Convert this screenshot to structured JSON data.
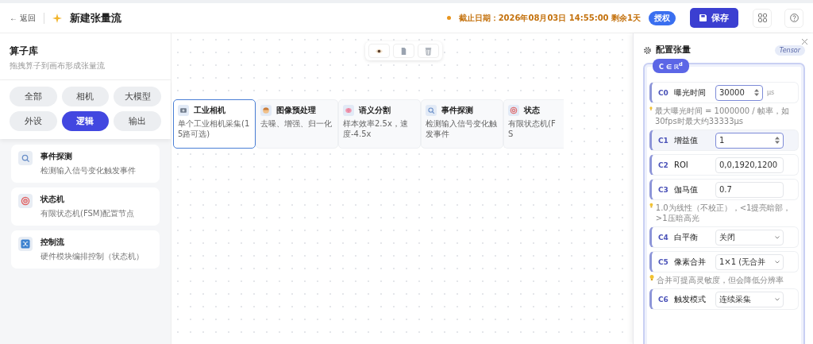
{
  "header": {
    "back": "← 返回",
    "title": "新建张量流",
    "deadline": "截止日期：2026年08月03日 14:55:00 剩余1天",
    "license": "授权",
    "save": "保存"
  },
  "library": {
    "title": "算子库",
    "subtitle": "拖拽算子到画布形成张量流",
    "categories": [
      {
        "label": "全部",
        "selected": false
      },
      {
        "label": "相机",
        "selected": false
      },
      {
        "label": "大模型",
        "selected": false
      },
      {
        "label": "外设",
        "selected": false
      },
      {
        "label": "逻辑",
        "selected": true
      },
      {
        "label": "输出",
        "selected": false
      }
    ],
    "items": [
      {
        "kind": "search",
        "title": "事件探测",
        "desc": "检测输入信号变化触发事件"
      },
      {
        "kind": "target",
        "title": "状态机",
        "desc": "有限状态机(FSM)配置节点"
      },
      {
        "kind": "shuffle",
        "title": "控制流",
        "desc": "硬件模块编排控制（状态机）"
      }
    ]
  },
  "nodes": [
    {
      "kind": "camera",
      "title": "工业相机",
      "desc": "单个工业相机采集(15路可选)",
      "selected": true
    },
    {
      "kind": "image",
      "title": "图像预处理",
      "desc": "去噪、增强、归一化",
      "selected": false
    },
    {
      "kind": "brain",
      "title": "语义分割",
      "desc": "样本效率2.5x，速度-4.5x",
      "selected": false
    },
    {
      "kind": "search",
      "title": "事件探测",
      "desc": "检测输入信号变化触发事件",
      "selected": false
    },
    {
      "kind": "target",
      "title": "状态",
      "desc": "有限状态机(FS",
      "selected": false
    }
  ],
  "panel": {
    "title": "配置张量",
    "tag": "Tensor",
    "badge": "C ∈ ℝ$^{d}$",
    "params": [
      {
        "kind": "number",
        "code": "C0",
        "label": "曝光时间",
        "value": "30000",
        "unit": "μs",
        "focused": false,
        "hint": "最大曝光时间 = 1000000 / 帧率，如30fps时最大约33333μs"
      },
      {
        "kind": "number",
        "code": "C1",
        "label": "增益值",
        "value": "1",
        "focused": true
      },
      {
        "kind": "text",
        "code": "C2",
        "label": "ROI",
        "value": "0,0,1920,1200",
        "focused": false
      },
      {
        "kind": "text",
        "code": "C3",
        "label": "伽马值",
        "value": "0.7",
        "focused": false,
        "hint": "1.0为线性（不校正），<1提亮暗部，>1压暗高光"
      },
      {
        "kind": "select",
        "code": "C4",
        "label": "白平衡",
        "value": "关闭",
        "focused": false
      },
      {
        "kind": "select",
        "code": "C5",
        "label": "像素合并",
        "value": "1×1 (无合并",
        "focused": false,
        "hint": "合并可提高灵敏度，但会降低分辨率"
      },
      {
        "kind": "select",
        "code": "C6",
        "label": "触发模式",
        "value": "连续采集",
        "focused": false
      }
    ]
  }
}
